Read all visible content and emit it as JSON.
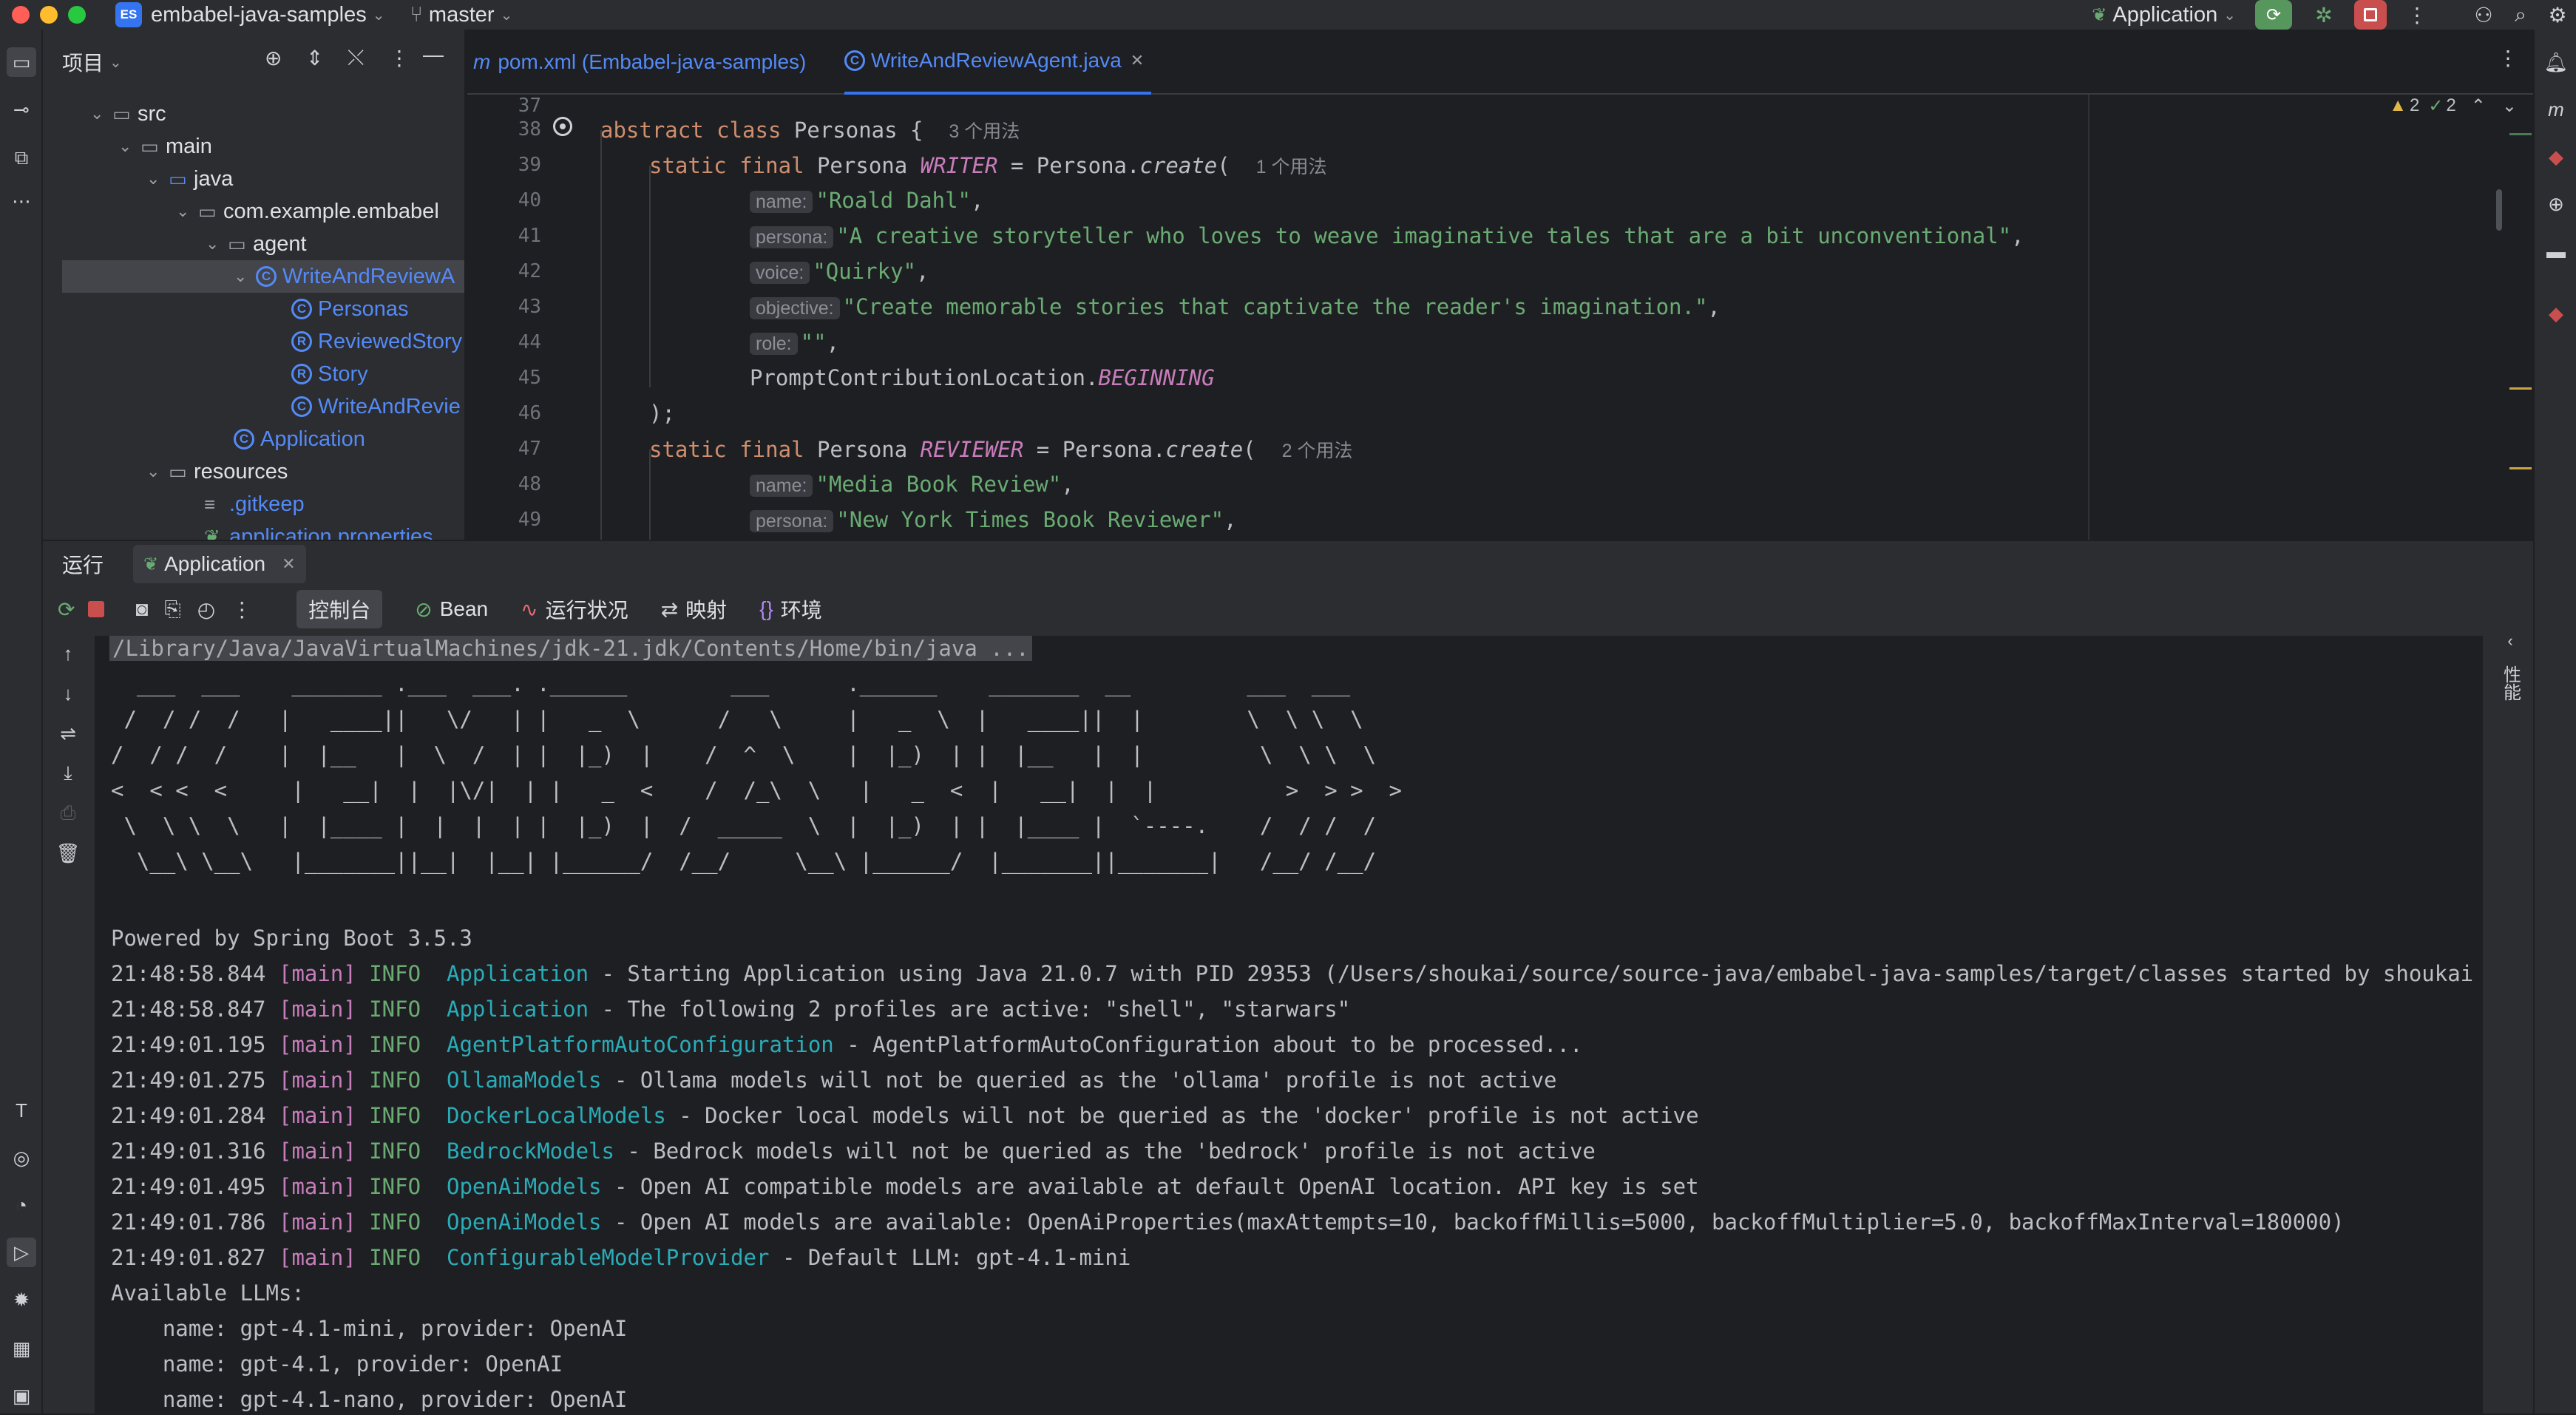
{
  "titlebar": {
    "project_badge": "ES",
    "project_name": "embabel-java-samples",
    "branch": "master",
    "run_config": "Application"
  },
  "project_panel": {
    "title": "项目",
    "tree": [
      {
        "label": "src",
        "type": "folder",
        "level": 0
      },
      {
        "label": "main",
        "type": "folder",
        "level": 1
      },
      {
        "label": "java",
        "type": "src-folder",
        "level": 2
      },
      {
        "label": "com.example.embabel",
        "type": "package",
        "level": 3
      },
      {
        "label": "agent",
        "type": "package",
        "level": 4
      },
      {
        "label": "WriteAndReviewA",
        "type": "class",
        "level": 5,
        "selected": true
      },
      {
        "label": "Personas",
        "type": "class",
        "level": 6
      },
      {
        "label": "ReviewedStory",
        "type": "record",
        "level": 6
      },
      {
        "label": "Story",
        "type": "record",
        "level": 6
      },
      {
        "label": "WriteAndRevie",
        "type": "class",
        "level": 6
      },
      {
        "label": "Application",
        "type": "spring-class",
        "level": 5
      },
      {
        "label": "resources",
        "type": "res-folder",
        "level": 2
      },
      {
        "label": ".gitkeep",
        "type": "file",
        "level": 3
      },
      {
        "label": "application.properties",
        "type": "properties",
        "level": 3
      }
    ]
  },
  "editor": {
    "tabs": [
      {
        "label": "pom.xml (Embabel-java-samples)",
        "active": false
      },
      {
        "label": "WriteAndReviewAgent.java",
        "active": true
      }
    ],
    "inspections": {
      "warnings": "2",
      "ok": "2"
    },
    "lines": [
      {
        "num": "37"
      },
      {
        "num": "38"
      },
      {
        "num": "39"
      },
      {
        "num": "40"
      },
      {
        "num": "41"
      },
      {
        "num": "42"
      },
      {
        "num": "43"
      },
      {
        "num": "44"
      },
      {
        "num": "45"
      },
      {
        "num": "46"
      },
      {
        "num": "47"
      },
      {
        "num": "48"
      },
      {
        "num": "49"
      }
    ],
    "code": {
      "l38_kw": "abstract class",
      "l38_name": " Personas {",
      "l38_hint": "3 个用法",
      "l39_kw": "static final",
      "l39_type": " Persona ",
      "l39_field": "WRITER",
      "l39_rest": " = Persona.",
      "l39_method": "create",
      "l39_paren": "(",
      "l39_hint": "1 个用法",
      "l40_label": "name:",
      "l40_value": "\"Roald Dahl\"",
      "l41_label": "persona:",
      "l41_value": "\"A creative storyteller who loves to weave imaginative tales that are a bit unconventional\"",
      "l42_label": "voice:",
      "l42_value": "\"Quirky\"",
      "l43_label": "objective:",
      "l43_value": "\"Create memorable stories that captivate the reader's imagination.\"",
      "l44_label": "role:",
      "l44_value": "\"\"",
      "l45_class": "PromptContributionLocation.",
      "l45_const": "BEGINNING",
      "l46": ");",
      "l47_kw": "static final",
      "l47_type": " Persona ",
      "l47_field": "REVIEWER",
      "l47_rest": " = Persona.",
      "l47_method": "create",
      "l47_paren": "(",
      "l47_hint": "2 个用法",
      "l48_label": "name:",
      "l48_value": "\"Media Book Review\"",
      "l49_label": "persona:",
      "l49_value": "\"New York Times Book Reviewer\""
    }
  },
  "run_panel": {
    "title": "运行",
    "tab": "Application",
    "subtabs": [
      "控制台",
      "Bean",
      "运行状况",
      "映射",
      "环境"
    ],
    "side_label": "性能",
    "console": {
      "command": "/Library/Java/JavaVirtualMachines/jdk-21.jdk/Contents/Home/bin/java ...",
      "banner": [
        "  ___  ___    _______ .___  ___. .______        ___      .______    _______  __         ___  ___",
        " /  / /  /   |   ____||   \\/   | |   _  \\      /   \\     |   _  \\  |   ____||  |        \\  \\ \\  \\",
        "/  / /  /    |  |__   |  \\  /  | |  |_)  |    /  ^  \\    |  |_)  | |  |__   |  |         \\  \\ \\  \\",
        "<  < <  <     |   __|  |  |\\/|  | |   _  <    /  /_\\  \\   |   _  <  |   __|  |  |          >  > >  >",
        " \\  \\ \\  \\   |  |____ |  |  |  | |  |_)  |  /  _____  \\  |  |_)  | |  |____ |  `----.    /  / /  /",
        "  \\__\\ \\__\\   |_______||__|  |__| |______/  /__/     \\__\\ |______/  |_______||_______|   /__/ /__/"
      ],
      "powered": "Powered by Spring Boot 3.5.3",
      "logs": [
        {
          "time": "21:48:58.844",
          "thread": "[main]",
          "level": "INFO",
          "logger": "Application",
          "msg": " - Starting Application using Java 21.0.7 with PID 29353 (/Users/shoukai/source/source-java/embabel-java-samples/target/classes started by shoukai in /Use"
        },
        {
          "time": "21:48:58.847",
          "thread": "[main]",
          "level": "INFO",
          "logger": "Application",
          "msg": " - The following 2 profiles are active: \"shell\", \"starwars\""
        },
        {
          "time": "21:49:01.195",
          "thread": "[main]",
          "level": "INFO",
          "logger": "AgentPlatformAutoConfiguration",
          "msg": " - AgentPlatformAutoConfiguration about to be processed..."
        },
        {
          "time": "21:49:01.275",
          "thread": "[main]",
          "level": "INFO",
          "logger": "OllamaModels",
          "msg": " - Ollama models will not be queried as the 'ollama' profile is not active"
        },
        {
          "time": "21:49:01.284",
          "thread": "[main]",
          "level": "INFO",
          "logger": "DockerLocalModels",
          "msg": " - Docker local models will not be queried as the 'docker' profile is not active"
        },
        {
          "time": "21:49:01.316",
          "thread": "[main]",
          "level": "INFO",
          "logger": "BedrockModels",
          "msg": " - Bedrock models will not be queried as the 'bedrock' profile is not active"
        },
        {
          "time": "21:49:01.495",
          "thread": "[main]",
          "level": "INFO",
          "logger": "OpenAiModels",
          "msg": " - Open AI compatible models are available at default OpenAI location. API key is set"
        },
        {
          "time": "21:49:01.786",
          "thread": "[main]",
          "level": "INFO",
          "logger": "OpenAiModels",
          "msg": " - Open AI models are available: OpenAiProperties(maxAttempts=10, backoffMillis=5000, backoffMultiplier=5.0, backoffMaxInterval=180000)"
        },
        {
          "time": "21:49:01.827",
          "thread": "[main]",
          "level": "INFO",
          "logger": "ConfigurableModelProvider",
          "msg": " - Default LLM: gpt-4.1-mini"
        }
      ],
      "llm_header": "Available LLMs:",
      "llms": [
        "    name: gpt-4.1-mini, provider: OpenAI",
        "    name: gpt-4.1, provider: OpenAI",
        "    name: gpt-4.1-nano, provider: OpenAI"
      ]
    }
  }
}
